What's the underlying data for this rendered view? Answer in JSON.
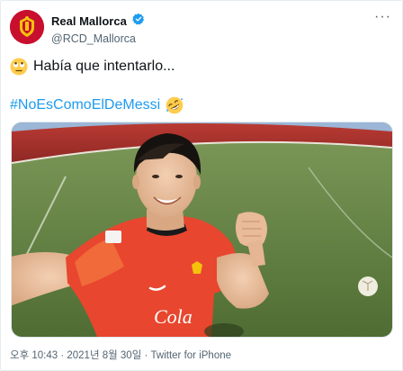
{
  "tweet": {
    "display_name": "Real Mallorca",
    "handle": "@RCD_Mallorca",
    "text": "Había que intentarlo...",
    "hashtag": "#NoEsComoElDeMessi",
    "more_glyph": "···"
  },
  "media": {
    "jersey_text": "Cola",
    "type": "video-still"
  },
  "meta": {
    "time": "오후 10:43",
    "separator": " · ",
    "date": "2021년 8월 30일",
    "source": "Twitter for iPhone"
  },
  "icons": [
    "club-crest-icon",
    "verified-badge-icon",
    "more-options-icon",
    "rolling-eyes-emoji-icon",
    "rofl-emoji-icon"
  ],
  "colors": {
    "brand_red": "#c8102e",
    "link_blue": "#1d9bf0",
    "muted_text": "#536471"
  }
}
